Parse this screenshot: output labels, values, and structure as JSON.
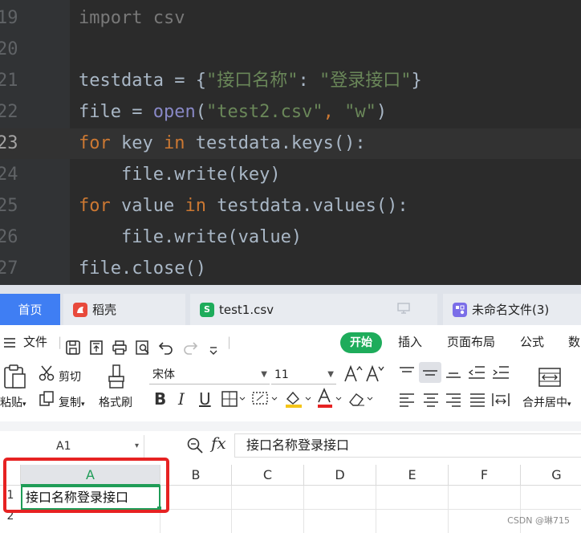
{
  "editor": {
    "lines": [
      {
        "num": "19",
        "parts": [
          [
            "import csv",
            "dim"
          ]
        ]
      },
      {
        "num": "20",
        "parts": []
      },
      {
        "num": "21",
        "parts": [
          [
            "testdata = {",
            ""
          ],
          [
            "\"接口名称\"",
            "str"
          ],
          [
            ": ",
            ""
          ],
          [
            "\"登录接口\"",
            "str"
          ],
          [
            "}",
            ""
          ]
        ]
      },
      {
        "num": "22",
        "parts": [
          [
            "file = ",
            ""
          ],
          [
            "open",
            "bi"
          ],
          [
            "(",
            ""
          ],
          [
            "\"test2.csv\"",
            "str"
          ],
          [
            ", ",
            "cm"
          ],
          [
            "\"w\"",
            "str"
          ],
          [
            ")",
            ""
          ]
        ]
      },
      {
        "num": "23",
        "parts": [
          [
            "for",
            "kw"
          ],
          [
            " key ",
            ""
          ],
          [
            "in",
            "kw"
          ],
          [
            " testdata.keys():",
            ""
          ]
        ],
        "current": true
      },
      {
        "num": "24",
        "parts": [
          [
            "    file.write(key)",
            ""
          ]
        ]
      },
      {
        "num": "25",
        "parts": [
          [
            "for",
            "kw"
          ],
          [
            " value ",
            ""
          ],
          [
            "in",
            "kw"
          ],
          [
            " testdata.values():",
            ""
          ]
        ]
      },
      {
        "num": "26",
        "parts": [
          [
            "    file.write(value)",
            ""
          ]
        ]
      },
      {
        "num": "27",
        "parts": [
          [
            "file.close()",
            ""
          ]
        ]
      }
    ]
  },
  "tabs": {
    "home": "首页",
    "docer": "稻壳",
    "csv": "test1.csv",
    "csv_icon": "S",
    "untitled": "未命名文件(3)"
  },
  "menu": {
    "file": "文件",
    "start": "开始",
    "insert": "插入",
    "page_layout": "页面布局",
    "formula": "公式",
    "data": "数"
  },
  "ribbon": {
    "paste": "粘贴",
    "cut": "剪切",
    "copy": "复制",
    "format_painter": "格式刷",
    "font_name": "宋体",
    "font_size": "11",
    "merge_center": "合并居中"
  },
  "formula_bar": {
    "name_box": "A1",
    "fx": "fx",
    "content": "接口名称登录接口"
  },
  "sheet": {
    "columns": [
      "A",
      "B",
      "C",
      "D",
      "E",
      "F",
      "G"
    ],
    "rows": [
      "1",
      "2"
    ],
    "a1_value": "接口名称登录接口"
  },
  "watermark": "CSDN @琳715",
  "colors": {
    "editor_bg": "#2b2b2b",
    "keyword": "#cc7832",
    "string": "#6a8759",
    "active_tab": "#3f7ef3",
    "start_green": "#1eac5b",
    "selection_green": "#1f9c57",
    "highlight_red": "#e62222"
  }
}
